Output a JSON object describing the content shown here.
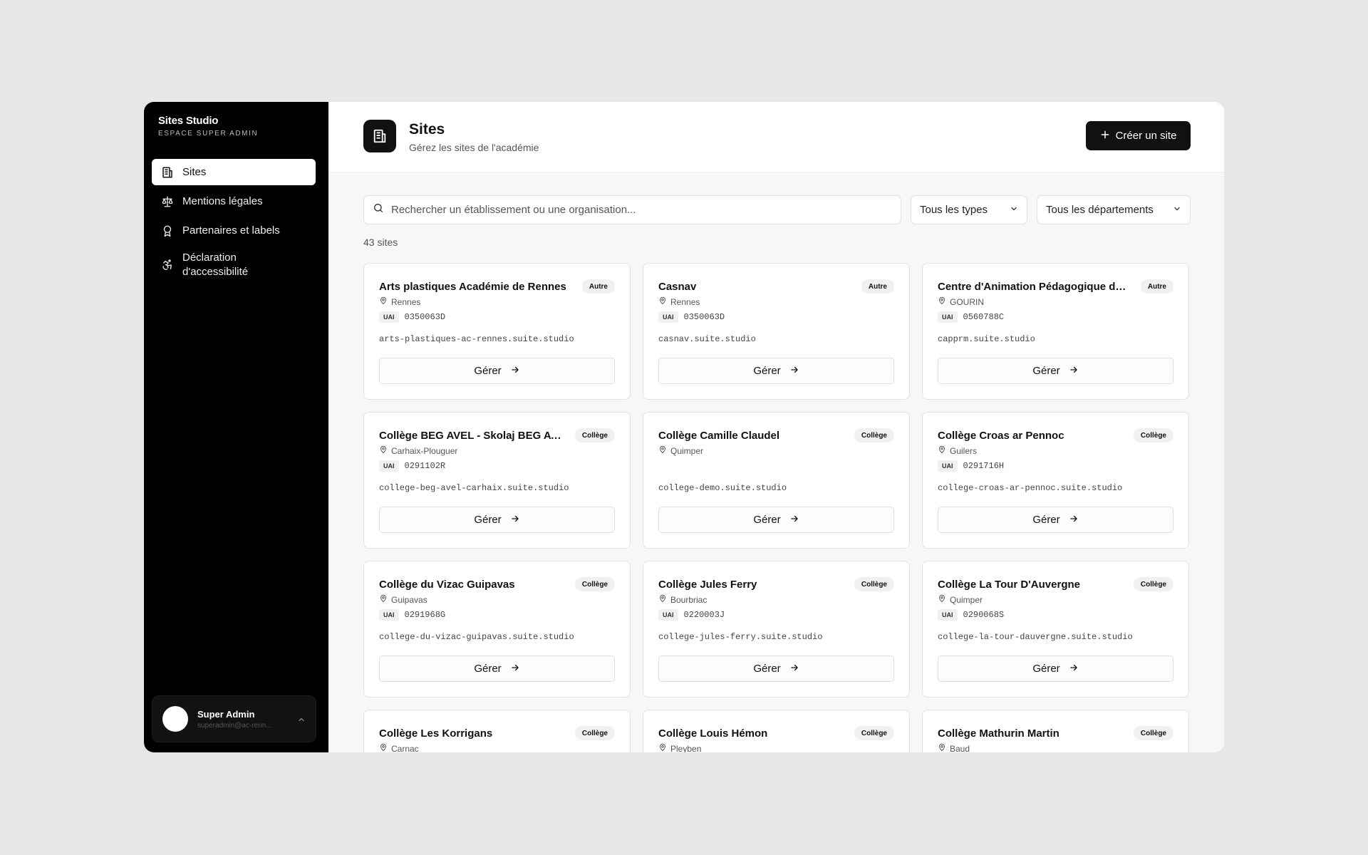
{
  "sidebar": {
    "brand_name": "Sites Studio",
    "brand_sub": "ESPACE SUPER ADMIN",
    "items": [
      {
        "label": "Sites",
        "icon": "building-icon",
        "active": true
      },
      {
        "label": "Mentions légales",
        "icon": "scale-icon"
      },
      {
        "label": "Partenaires et labels",
        "icon": "award-icon"
      },
      {
        "label": "Déclaration d'accessibilité",
        "icon": "accessibility-icon"
      }
    ],
    "user": {
      "name": "Super Admin",
      "email": "superadmin@ac-renn..."
    }
  },
  "header": {
    "title": "Sites",
    "subtitle": "Gérez les sites de l'académie",
    "create_label": "Créer un site"
  },
  "toolbar": {
    "search_placeholder": "Rechercher un établissement ou une organisation...",
    "type_filter": "Tous les types",
    "dept_filter": "Tous les départements"
  },
  "count_label": "43 sites",
  "manage_label": "Gérer",
  "uai_tag": "UAI",
  "sites": [
    {
      "name": "Arts plastiques Académie de Rennes",
      "type": "Autre",
      "city": "Rennes",
      "uai": "0350063D",
      "domain": "arts-plastiques-ac-rennes.suite.studio"
    },
    {
      "name": "Casnav",
      "type": "Autre",
      "city": "Rennes",
      "uai": "0350063D",
      "domain": "casnav.suite.studio"
    },
    {
      "name": "Centre d'Animation Pédagogique du ...",
      "type": "Autre",
      "city": "GOURIN",
      "uai": "0560788C",
      "domain": "capprm.suite.studio"
    },
    {
      "name": "Collège BEG AVEL - Skolaj BEG AVEL",
      "type": "Collège",
      "city": "Carhaix-Plouguer",
      "uai": "0291102R",
      "domain": "college-beg-avel-carhaix.suite.studio"
    },
    {
      "name": "Collège Camille Claudel",
      "type": "Collège",
      "city": "Quimper",
      "uai": "",
      "domain": "college-demo.suite.studio"
    },
    {
      "name": "Collège Croas ar Pennoc",
      "type": "Collège",
      "city": "Guilers",
      "uai": "0291716H",
      "domain": "college-croas-ar-pennoc.suite.studio"
    },
    {
      "name": "Collège du Vizac Guipavas",
      "type": "Collège",
      "city": "Guipavas",
      "uai": "0291968G",
      "domain": "college-du-vizac-guipavas.suite.studio"
    },
    {
      "name": "Collège Jules Ferry",
      "type": "Collège",
      "city": "Bourbriac",
      "uai": "0220003J",
      "domain": "college-jules-ferry.suite.studio"
    },
    {
      "name": "Collège La Tour D'Auvergne",
      "type": "Collège",
      "city": "Quimper",
      "uai": "0290068S",
      "domain": "college-la-tour-dauvergne.suite.studio"
    },
    {
      "name": "Collège Les Korrigans",
      "type": "Collège",
      "city": "Carnac",
      "uai": "",
      "domain": ""
    },
    {
      "name": "Collège Louis Hémon",
      "type": "Collège",
      "city": "Pleyben",
      "uai": "",
      "domain": ""
    },
    {
      "name": "Collège Mathurin Martin",
      "type": "Collège",
      "city": "Baud",
      "uai": "",
      "domain": ""
    }
  ]
}
